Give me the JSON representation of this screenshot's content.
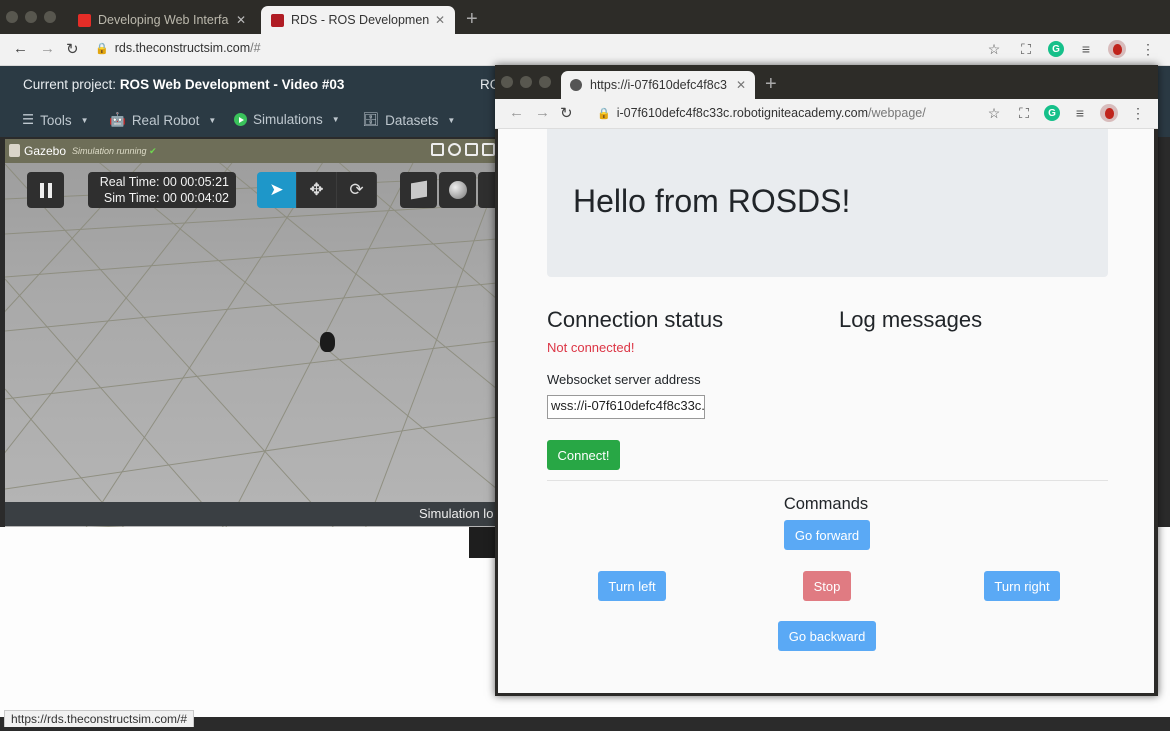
{
  "browser": {
    "tabs": [
      {
        "title": "Developing Web Interfa",
        "favicon_color": "#e52d27"
      },
      {
        "title": "RDS - ROS Development S",
        "favicon_color": "#b01c24"
      }
    ],
    "new_tab": "+",
    "url_host": "rds.theconstructsim.com",
    "url_path": "/#",
    "status_url": "https://rds.theconstructsim.com/#"
  },
  "rds": {
    "project_label": "Current project:",
    "project_name": "ROS Web Development - Video #03",
    "header_right": "RO",
    "menu": [
      {
        "label": "Tools",
        "icon": "menu-icon"
      },
      {
        "label": "Real Robot",
        "icon": "robot-icon"
      },
      {
        "label": "Simulations",
        "icon": "play-icon"
      },
      {
        "label": "Datasets",
        "icon": "database-icon"
      }
    ]
  },
  "gazebo": {
    "title": "Gazebo",
    "status": "Simulation running",
    "real_time": "Real Time: 00 00:05:21",
    "sim_time": "Sim Time: 00 00:04:02",
    "footer": "Simulation lo"
  },
  "popup": {
    "tab_title": "https://i-07f610defc4f8c3",
    "new_tab": "+",
    "url_host": "i-07f610defc4f8c33c.robotigniteacademy.com",
    "url_path": "/webpage/",
    "page": {
      "heading": "Hello from ROSDS!",
      "connection_title": "Connection status",
      "connection_status": "Not connected!",
      "log_title": "Log messages",
      "ws_label": "Websocket server address",
      "ws_value": "wss://i-07f610defc4f8c33c.",
      "connect_label": "Connect!",
      "commands_title": "Commands",
      "forward": "Go forward",
      "left": "Turn left",
      "stop": "Stop",
      "right": "Turn right",
      "backward": "Go backward"
    }
  },
  "colors": {
    "connect": "#28a745",
    "command_blue": "#5aa9f5",
    "stop_red": "#e07b82",
    "error_text": "#dc3545",
    "rds_header": "#2b3a44",
    "gazebo_selected": "#1e97c9"
  }
}
